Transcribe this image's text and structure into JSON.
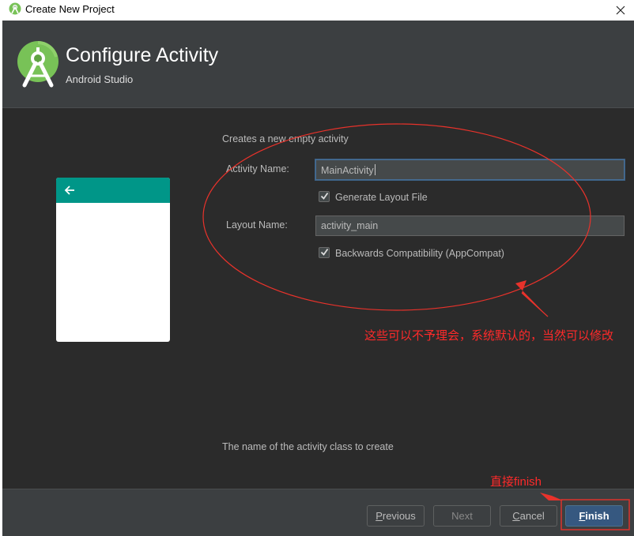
{
  "window": {
    "title": "Create New Project",
    "close_glyph": "✕",
    "icon": "android-studio-icon"
  },
  "header": {
    "title": "Configure Activity",
    "subtitle": "Android Studio",
    "logo": "android-studio-logo"
  },
  "form": {
    "description": "Creates a new empty activity",
    "activity_name_label": "Activity Name:",
    "activity_name_value": "MainActivity",
    "generate_layout_label": "Generate Layout File",
    "generate_layout_checked": true,
    "layout_name_label": "Layout Name:",
    "layout_name_value": "activity_main",
    "backwards_compat_label": "Backwards Compatibility (AppCompat)",
    "backwards_compat_checked": true,
    "hint": "The name of the activity class to create"
  },
  "preview": {
    "toolbar_color": "#009688",
    "back_icon": "arrow-left-icon"
  },
  "buttons": {
    "previous_first": "P",
    "previous_rest": "revious",
    "next": "Next",
    "cancel_first": "C",
    "cancel_rest": "ancel",
    "finish_first": "F",
    "finish_rest": "inish"
  },
  "annotations": {
    "note_defaults": "这些可以不予理会，系统默认的，当然可以修改",
    "note_finish": "直接finish",
    "color": "#ff2a2a"
  }
}
